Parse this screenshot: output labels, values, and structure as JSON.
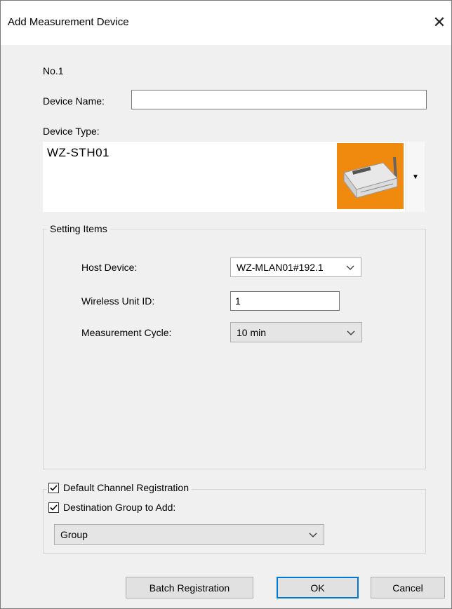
{
  "window": {
    "title": "Add Measurement Device",
    "close_glyph": "✕"
  },
  "form": {
    "number_label": "No.1",
    "device_name_label": "Device Name:",
    "device_name_value": "",
    "device_type_label": "Device Type:",
    "device_type_value": "WZ-STH01",
    "device_image_icon": "wireless-logger-device-image"
  },
  "setting_items": {
    "legend": "Setting Items",
    "host_device_label": "Host Device:",
    "host_device_value": "WZ-MLAN01#192.1",
    "wireless_unit_id_label": "Wireless Unit ID:",
    "wireless_unit_id_value": "1",
    "measurement_cycle_label": "Measurement Cycle:",
    "measurement_cycle_value": "10 min"
  },
  "options": {
    "default_channel_label": "Default Channel Registration",
    "default_channel_checked": true,
    "destination_group_label": "Destination Group to Add:",
    "destination_group_checked": true,
    "group_value": "Group"
  },
  "buttons": {
    "batch_label": "Batch Registration",
    "ok_label": "OK",
    "cancel_label": "Cancel"
  },
  "colors": {
    "accent": "#0078d7",
    "device_image_bg": "#f08a0e"
  }
}
